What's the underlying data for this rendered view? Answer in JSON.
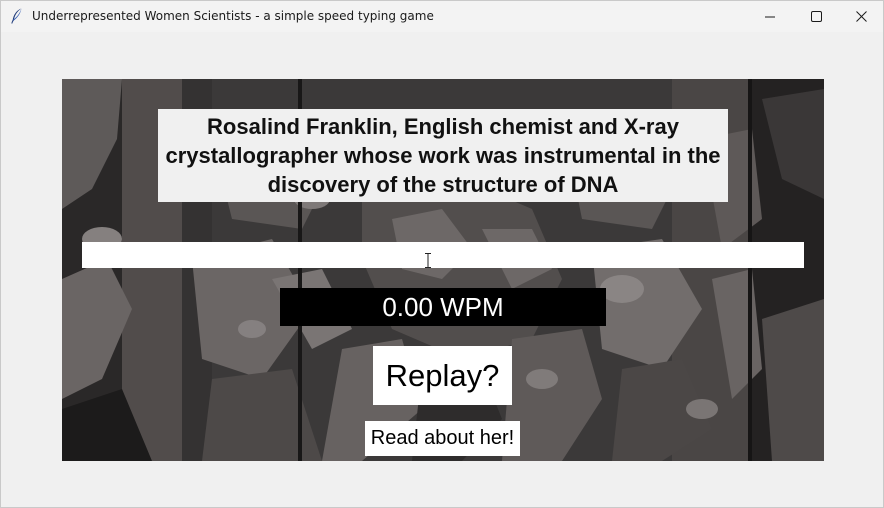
{
  "window": {
    "title": "Underrepresented Women Scientists - a simple speed typing game",
    "app_icon": "feather-icon",
    "controls": {
      "minimize_icon": "minimize-icon",
      "maximize_icon": "maximize-icon",
      "close_icon": "close-icon"
    }
  },
  "game": {
    "background_image": "portrait-stencil-background",
    "prompt_text": "Rosalind Franklin, English chemist and X-ray crystallographer whose work was instrumental in the discovery of the structure of DNA",
    "typing_input": {
      "value": "",
      "placeholder": ""
    },
    "wpm_display": "0.00 WPM",
    "replay_label": "Replay?",
    "read_about_label": "Read about her!"
  },
  "colors": {
    "window_bg": "#f0f0f0",
    "stage_bg": "#3a3838",
    "wpm_bg": "#000000",
    "wpm_text": "#ffffff",
    "button_bg": "#ffffff"
  }
}
